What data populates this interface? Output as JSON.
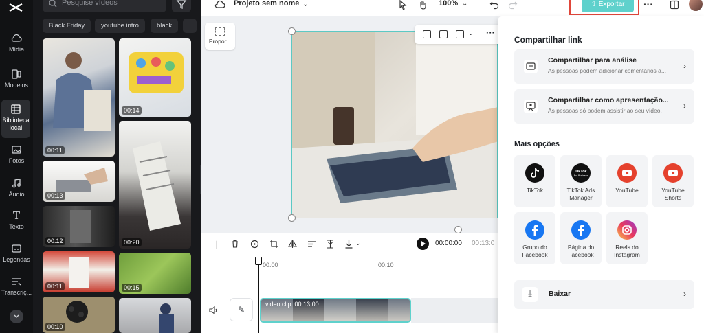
{
  "media": {
    "search_placeholder": "Pesquise vídeos",
    "chips": [
      "Black Friday",
      "youtube intro",
      "black"
    ],
    "durations": [
      "00:11",
      "00:14",
      "00:13",
      "00:12",
      "00:20",
      "00:11",
      "00:15",
      "00:10"
    ]
  },
  "nav": {
    "items": [
      {
        "label": "Mídia"
      },
      {
        "label": "Modelos"
      },
      {
        "label": "Biblioteca local"
      },
      {
        "label": "Fotos"
      },
      {
        "label": "Áudio"
      },
      {
        "label": "Texto"
      },
      {
        "label": "Legendas"
      },
      {
        "label": "Transcriç..."
      }
    ]
  },
  "topbar": {
    "project_title": "Projeto sem nome",
    "zoom": "100%",
    "export_label": "Exportar"
  },
  "canvas": {
    "ratio_label": "Propor..."
  },
  "timeline": {
    "current_time": "00:00:00",
    "total_time": "00:13:0",
    "ruler": [
      "00:00",
      "00:10"
    ],
    "clip_label": "video clip",
    "clip_duration": "00:13:00"
  },
  "export_panel": {
    "share_title": "Compartilhar link",
    "share_review_title": "Compartilhar para análise",
    "share_review_sub": "As pessoas podem adicionar comentários a...",
    "share_present_title": "Compartilhar como apresentação...",
    "share_present_sub": "As pessoas só podem assistir ao seu vídeo.",
    "more_title": "Mais opções",
    "options": [
      {
        "label": "TikTok",
        "icon": "tiktok-icon"
      },
      {
        "label": "TikTok Ads Manager",
        "icon": "tiktok-business-icon"
      },
      {
        "label": "YouTube",
        "icon": "youtube-icon"
      },
      {
        "label": "YouTube Shorts",
        "icon": "youtube-shorts-icon"
      },
      {
        "label": "Grupo do Facebook",
        "icon": "facebook-icon"
      },
      {
        "label": "Página do Facebook",
        "icon": "facebook-icon"
      },
      {
        "label": "Reels do Instagram",
        "icon": "instagram-icon"
      }
    ],
    "download_label": "Baixar"
  },
  "colors": {
    "accent": "#5fd1cc",
    "export_outline": "#e0463a",
    "youtube_red": "#e5412d",
    "facebook_blue": "#1877f2"
  }
}
